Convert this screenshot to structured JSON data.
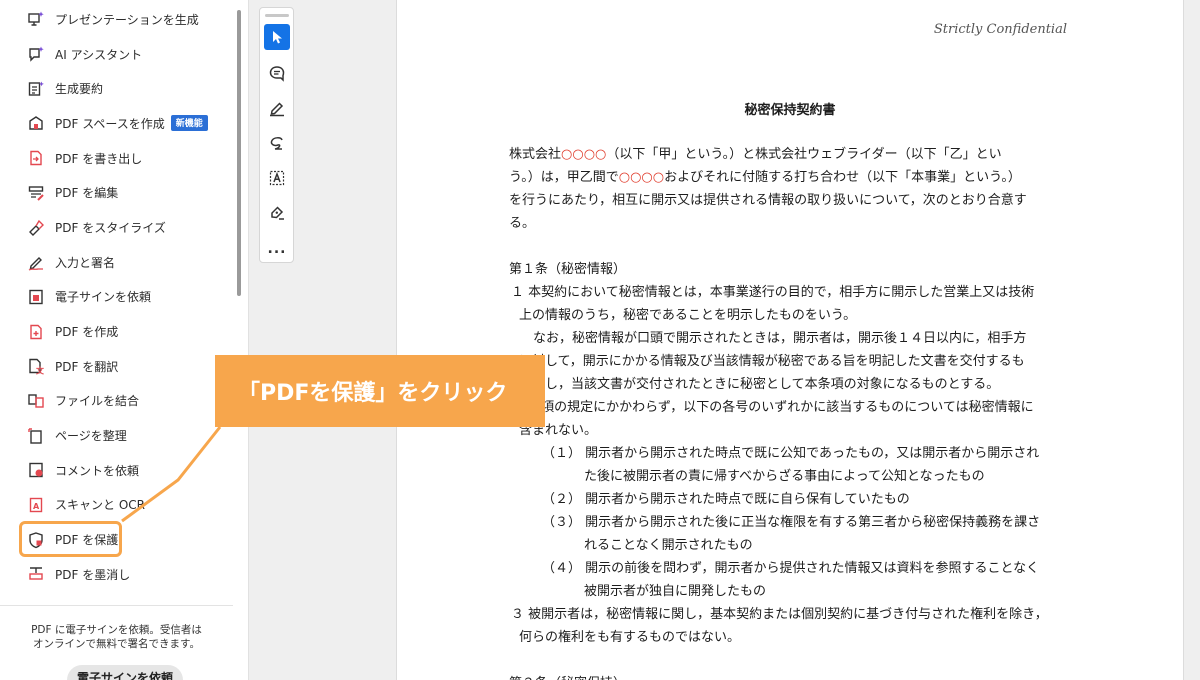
{
  "sidebar": {
    "items": [
      {
        "label": "プレゼンテーションを生成",
        "icon": "presentation-sparkle-icon"
      },
      {
        "label": "AI アシスタント",
        "icon": "ai-assistant-icon"
      },
      {
        "label": "生成要約",
        "icon": "generative-summary-icon"
      },
      {
        "label": "PDF スペースを作成",
        "icon": "pdf-space-icon",
        "badge": "新機能"
      },
      {
        "label": "PDF を書き出し",
        "icon": "export-pdf-icon"
      },
      {
        "label": "PDF を編集",
        "icon": "edit-pdf-icon"
      },
      {
        "label": "PDF をスタイライズ",
        "icon": "stylize-pdf-icon"
      },
      {
        "label": "入力と署名",
        "icon": "fill-sign-icon"
      },
      {
        "label": "電子サインを依頼",
        "icon": "request-esign-icon"
      },
      {
        "label": "PDF を作成",
        "icon": "create-pdf-icon"
      },
      {
        "label": "PDF を翻訳",
        "icon": "translate-pdf-icon"
      },
      {
        "label": "ファイルを結合",
        "icon": "combine-files-icon"
      },
      {
        "label": "ページを整理",
        "icon": "organize-pages-icon"
      },
      {
        "label": "コメントを依頼",
        "icon": "request-comments-icon"
      },
      {
        "label": "スキャンと OCR",
        "icon": "scan-ocr-icon"
      },
      {
        "label": "PDF を保護",
        "icon": "protect-pdf-icon"
      },
      {
        "label": "PDF を墨消し",
        "icon": "redact-pdf-icon"
      }
    ],
    "footer_text_1": "PDF に電子サインを依頼。受信者は",
    "footer_text_2": "オンラインで無料で署名できます。",
    "footer_button": "電子サインを依頼"
  },
  "toolbar": {
    "tools": [
      "select-arrow-icon",
      "add-comment-icon",
      "highlight-pen-icon",
      "freehand-draw-icon",
      "add-text-icon",
      "sign-icon",
      "more-icon"
    ],
    "more_label": "..."
  },
  "document": {
    "header": "Strictly Confidential",
    "title": "秘密保持契約書",
    "p1_a": "株式会社",
    "p1_red_1": "○○○○",
    "p1_b": "（以下「甲」という。）と株式会社ウェブライダー（以下「乙」とい",
    "p1_c": "う。）は，甲乙間で",
    "p1_red_2": "○○○○",
    "p1_d": "およびそれに付随する打ち合わせ（以下「本事業」という。）",
    "p1_e": "を行うにあたり，相互に開示又は提供される情報の取り扱いについて，次のとおり合意す",
    "p1_f": "る。",
    "art1_heading": "第１条（秘密情報）",
    "art1_1a": "１ 本契約において秘密情報とは，本事業遂行の目的で，相手方に開示した営業上又は技術",
    "art1_1b": "上の情報のうち，秘密であることを明示したものをいう。",
    "art1_2a": "なお，秘密情報が口頭で開示されたときは，開示者は，開示後１４日以内に，相手方",
    "art1_2b": "に対して，開示にかかる情報及び当該情報が秘密である旨を明記した文書を交付するも",
    "art1_2c": "のとし，当該文書が交付されたときに秘密として本条項の対象になるものとする。",
    "art1_3a": "２ 前項の規定にかかわらず，以下の各号のいずれかに該当するものについては秘密情報に",
    "art1_3b": "含まれない。",
    "item1a": "（１） 開示者から開示された時点で既に公知であったもの，又は開示者から開示され",
    "item1b": "た後に被開示者の責に帰すべからざる事由によって公知となったもの",
    "item2": "（２） 開示者から開示された時点で既に自ら保有していたもの",
    "item3a": "（３） 開示者から開示された後に正当な権限を有する第三者から秘密保持義務を課さ",
    "item3b": "れることなく開示されたもの",
    "item4a": "（４） 開示の前後を問わず，開示者から提供された情報又は資料を参照することなく",
    "item4b": "被開示者が独自に開発したもの",
    "art1_4a": "３ 被開示者は，秘密情報に関し，基本契約または個別契約に基づき付与された権利を除き，",
    "art1_4b": "何らの権利をも有するものではない。",
    "art2_heading": "第２条（秘密保持）"
  },
  "callout": {
    "text": "「PDFを保護」をクリック"
  },
  "colors": {
    "accent": "#1473e6",
    "callout": "#f7a64c",
    "badge": "#2b6fd6",
    "placeholder_red": "#e03b2b"
  }
}
